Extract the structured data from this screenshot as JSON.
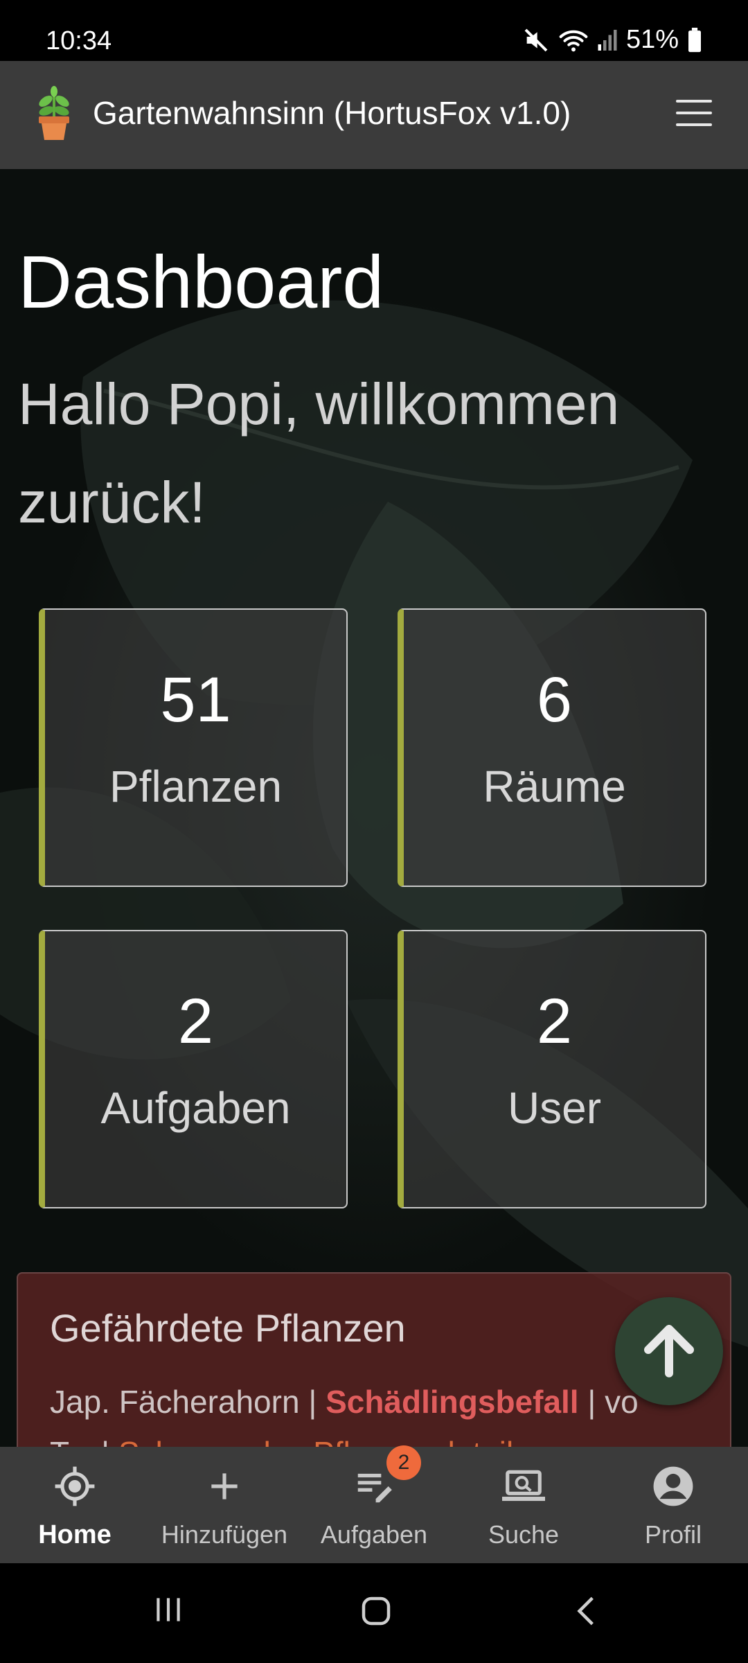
{
  "status": {
    "time": "10:34",
    "battery": "51%"
  },
  "appbar": {
    "title": "Gartenwahnsinn (HortusFox v1.0)",
    "logo_icon": "potted-plant-icon",
    "menu_icon": "hamburger-menu-icon"
  },
  "dashboard": {
    "heading": "Dashboard",
    "greeting": "Hallo Popi, willkommen zurück!",
    "cards": [
      {
        "value": "51",
        "label": "Pflanzen"
      },
      {
        "value": "6",
        "label": "Räume"
      },
      {
        "value": "2",
        "label": "Aufgaben"
      },
      {
        "value": "2",
        "label": "User"
      }
    ]
  },
  "endangered": {
    "title": "Gefährdete Pflanzen",
    "line1_name": "Jap. Fächerahorn",
    "line1_sep1": " | ",
    "line1_status": "Schädlingsbefall",
    "line1_sep2": " | vo",
    "line2_start": "T... | ",
    "line2_link": "Schauen des Pflanzendetails"
  },
  "nav": {
    "items": [
      {
        "label": "Home",
        "icon": "home-target-icon"
      },
      {
        "label": "Hinzufügen",
        "icon": "plus-icon"
      },
      {
        "label": "Aufgaben",
        "icon": "tasks-icon"
      },
      {
        "label": "Suche",
        "icon": "search-laptop-icon"
      },
      {
        "label": "Profil",
        "icon": "profile-icon"
      }
    ],
    "tasks_badge": "2"
  },
  "colors": {
    "accent": "#a3ab3f",
    "danger_bg": "#582222",
    "danger_text": "#e05d5d",
    "bar": "#3b3b3b"
  }
}
